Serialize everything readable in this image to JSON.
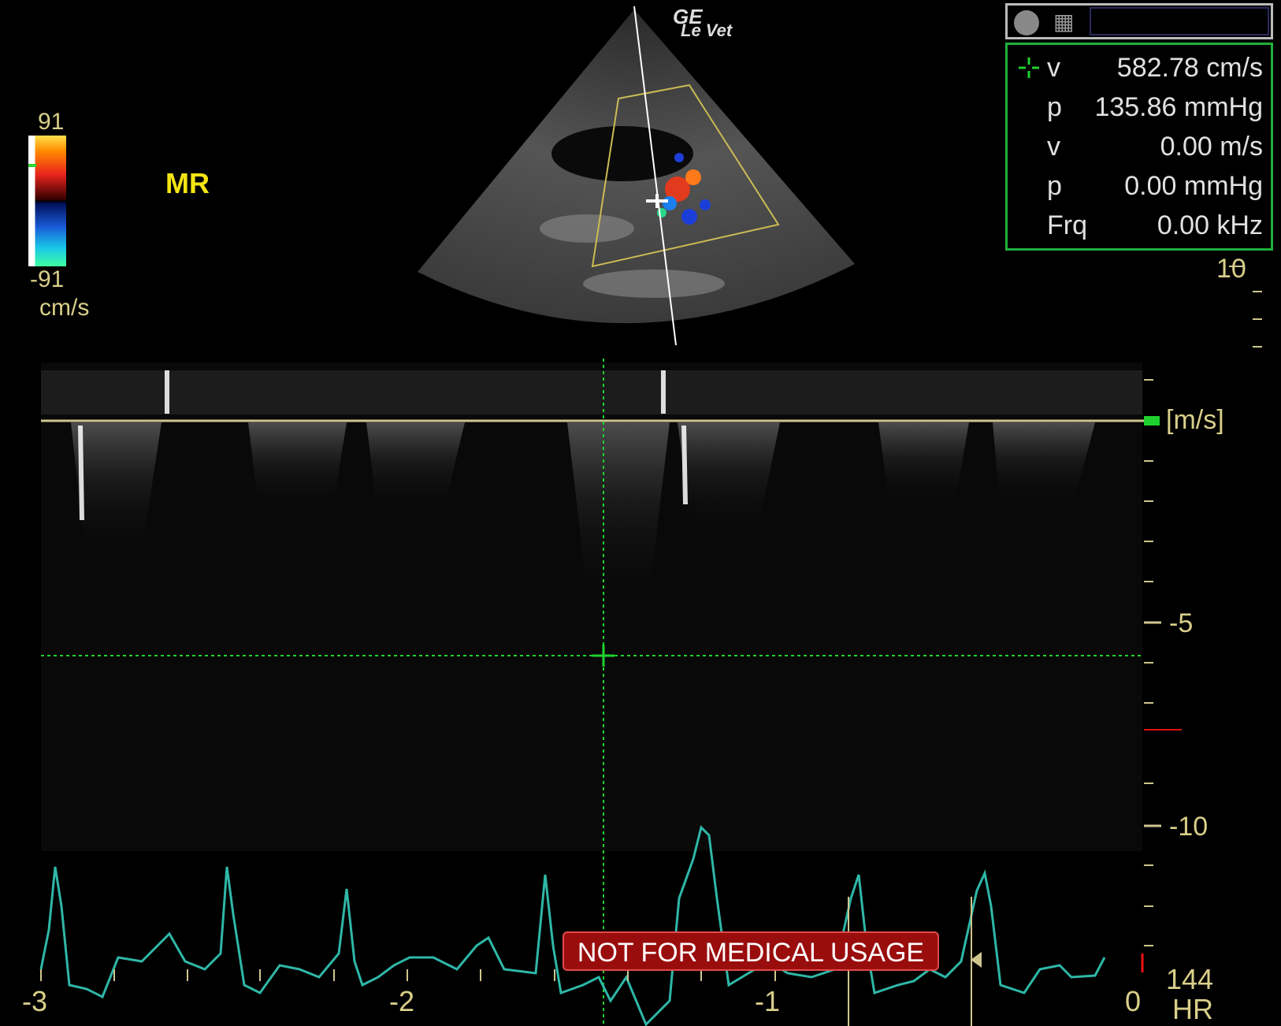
{
  "brand": {
    "logo": "GE",
    "subtitle": "Le Vet"
  },
  "color_scale": {
    "max": "91",
    "min": "-91",
    "unit": "cm/s"
  },
  "mode_label": "MR",
  "measurements": [
    {
      "key": "v",
      "value": "582.78 cm/s"
    },
    {
      "key": "p",
      "value": "135.86 mmHg"
    },
    {
      "key": "v",
      "value": "0.00 m/s"
    },
    {
      "key": "p",
      "value": "0.00 mmHg"
    },
    {
      "key": "Frq",
      "value": "0.00 kHz"
    }
  ],
  "top_depth_label": "10",
  "velocity_scale": {
    "unit": "[m/s]",
    "labels": [
      "-5",
      "-10"
    ]
  },
  "time_axis": [
    "-3",
    "-2",
    "-1",
    "0"
  ],
  "warning": "NOT FOR MEDICAL USAGE",
  "heart_rate": {
    "value": "144",
    "label": "HR"
  },
  "colors": {
    "baseline": "#cfc68f",
    "ecg": "#2fb7a8",
    "cursor": "#1fd12f",
    "warning_bg": "#9a0d0d"
  },
  "icons": [
    "record-icon",
    "display-icon",
    "crosshair-icon"
  ]
}
